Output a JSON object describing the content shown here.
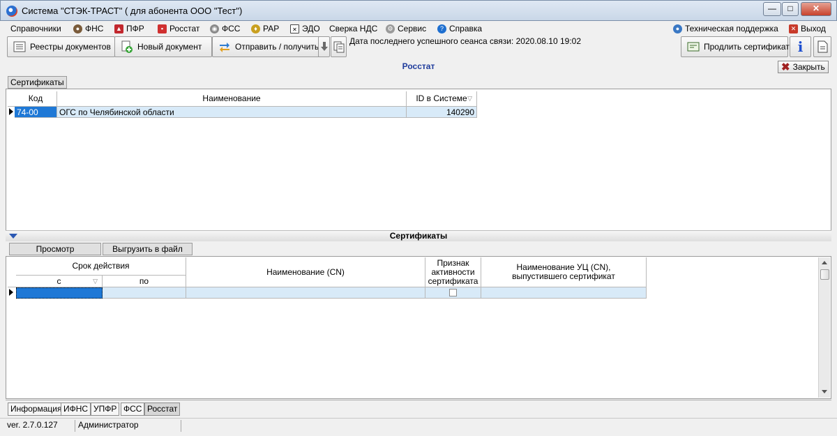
{
  "window": {
    "title": "Система \"СТЭК-ТРАСТ\" ( для абонента ООО \"Тест\")",
    "minimize": "—",
    "maximize": "□",
    "close": "✕"
  },
  "menu": {
    "items": [
      "Справочники",
      "ФНС",
      "ПФР",
      "Росстат",
      "ФСС",
      "РАР",
      "ЭДО",
      "Сверка НДС",
      "Сервис",
      "Справка"
    ],
    "support": "Техническая поддержка",
    "exit": "Выход"
  },
  "toolbar": {
    "registries": "Реестры документов",
    "new_doc": "Новый документ",
    "send_receive": "Отправить / получить",
    "session": "Дата последнего успешного сеанса связи: 2020.08.10 19:02",
    "renew": "Продлить сертификат"
  },
  "section": {
    "title": "Росстат",
    "close": "Закрыть",
    "tab": "Сертификаты"
  },
  "grid1": {
    "headers": [
      "Код",
      "Наименование",
      "ID в Системе"
    ],
    "rows": [
      {
        "code": "74-00",
        "name": "ОГС по Челябинской области",
        "id": "140290"
      }
    ]
  },
  "certs": {
    "title": "Сертификаты",
    "view": "Просмотр",
    "export": "Выгрузить в файл",
    "headers": {
      "validity": "Срок действия",
      "from": "с",
      "to": "по",
      "cn": "Наименование (CN)",
      "active": "Признак активности сертификата",
      "issuer": "Наименование УЦ (CN), выпустившего сертификат"
    }
  },
  "bottom_tabs": [
    "Информация",
    "ИФНС",
    "УПФР",
    "ФСС",
    "Росстат"
  ],
  "status": {
    "version": "ver. 2.7.0.127",
    "user": "Администратор"
  },
  "colors": {
    "accent_blue": "#1f3c9c",
    "row_selected": "#d8eaf8",
    "cell_focus": "#1e78d6"
  }
}
